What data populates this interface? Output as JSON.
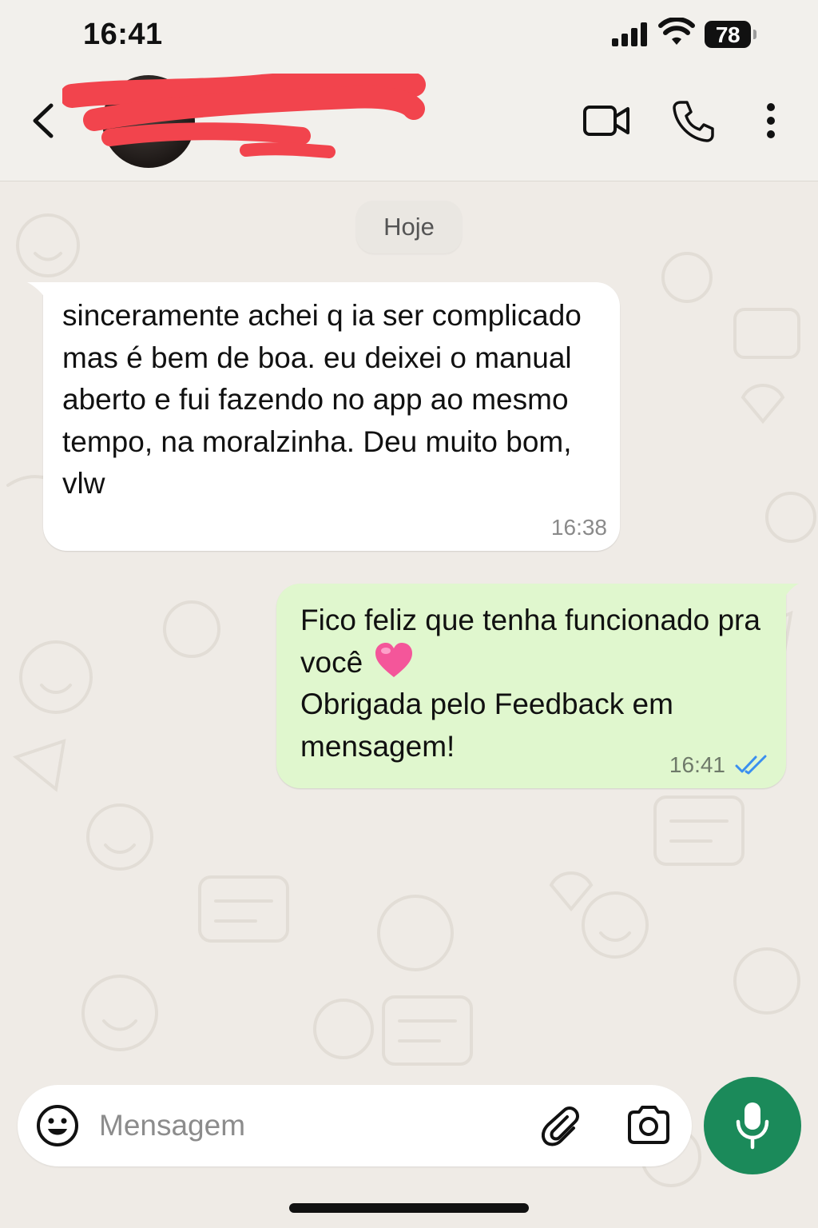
{
  "status_bar": {
    "time": "16:41",
    "battery": "78"
  },
  "header": {
    "contact_name_redacted": true
  },
  "chat": {
    "date_divider": "Hoje",
    "messages": [
      {
        "direction": "incoming",
        "text": "sinceramente achei q ia ser complicado mas é bem de boa. eu deixei o manual aberto e fui fazendo no app ao mesmo tempo, na moralzinha. Deu muito bom, vlw",
        "time": "16:38"
      },
      {
        "direction": "outgoing",
        "text_line1": "Fico feliz que tenha funcionado pra você",
        "emoji": "pink-heart",
        "text_line2": "Obrigada pelo Feedback em mensagem!",
        "time": "16:41",
        "status": "read"
      }
    ]
  },
  "composer": {
    "placeholder": "Mensagem"
  },
  "icons": {
    "back": "chevron-left-icon",
    "video": "video-camera-icon",
    "call": "phone-icon",
    "more": "more-vertical-icon",
    "emoji": "smiley-icon",
    "attach": "paperclip-icon",
    "camera": "camera-icon",
    "mic": "microphone-icon"
  },
  "colors": {
    "outgoing_bubble": "#e0f7ce",
    "incoming_bubble": "#ffffff",
    "mic_button": "#1b8a5a",
    "read_ticks": "#3a8ff0",
    "redaction": "#f2444d"
  }
}
